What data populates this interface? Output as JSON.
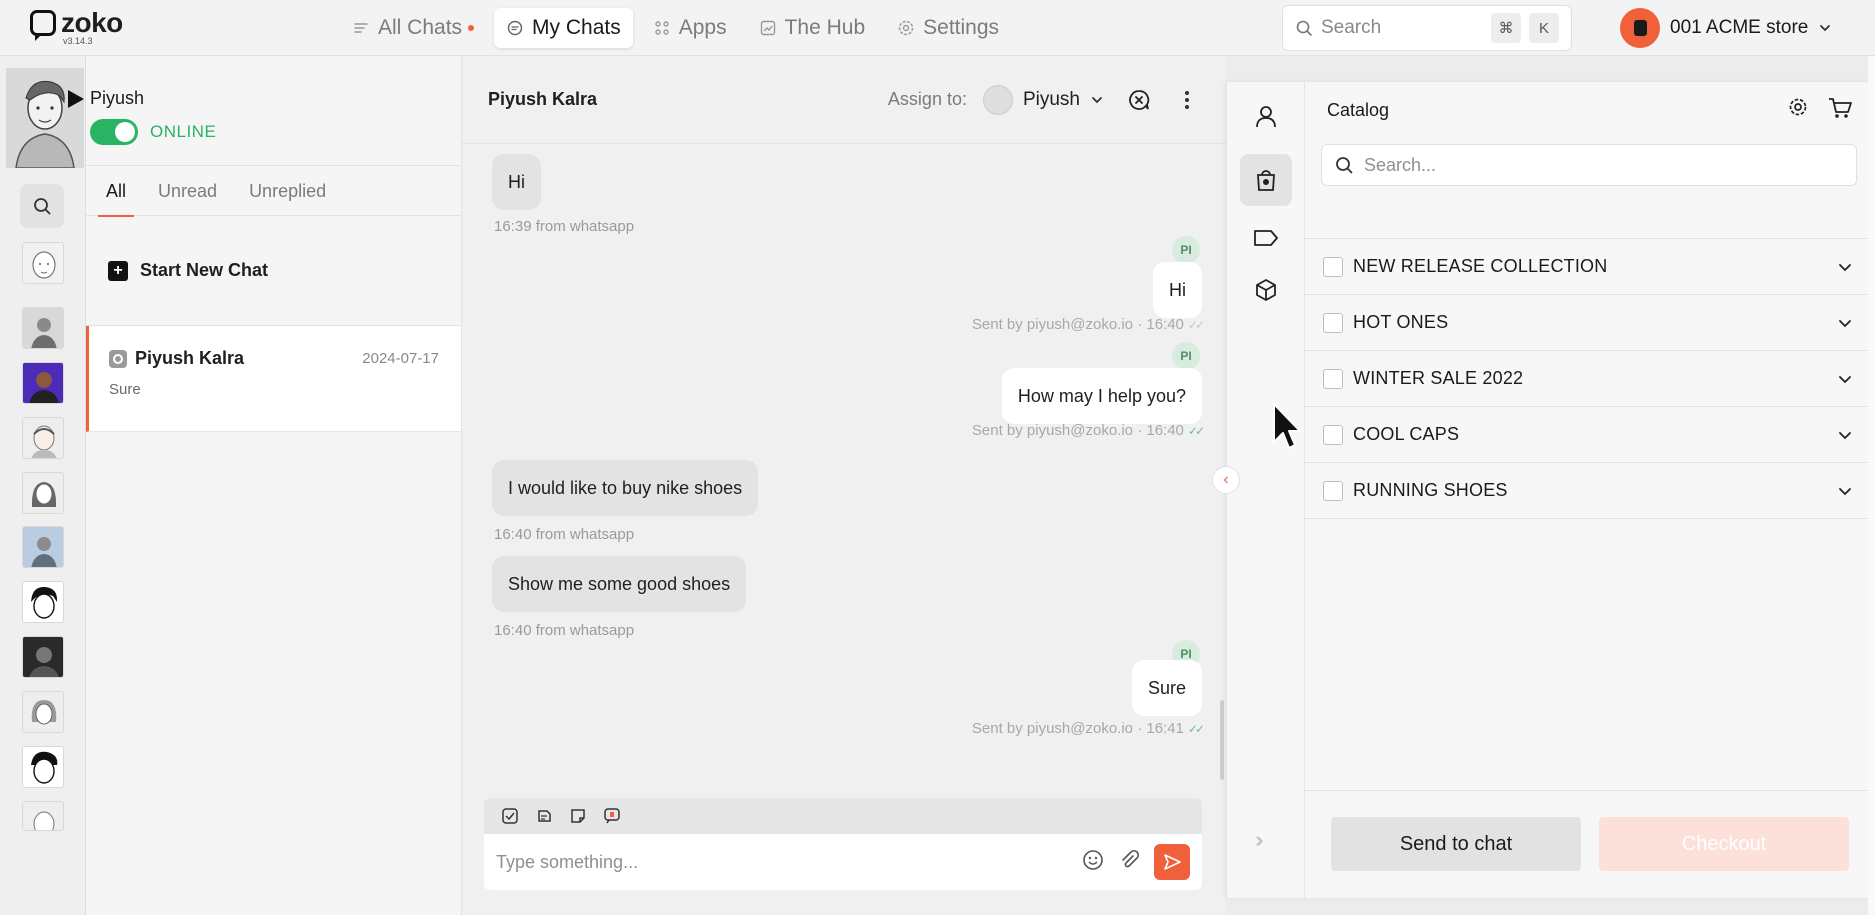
{
  "app": {
    "logo_name": "zoko",
    "version": "v3.14.3"
  },
  "nav": {
    "items": [
      {
        "label": "All Chats",
        "icon": "list-icon",
        "has_dot": true
      },
      {
        "label": "My Chats",
        "icon": "chat-bubble-icon",
        "active": true
      },
      {
        "label": "Apps",
        "icon": "grid-icon"
      },
      {
        "label": "The Hub",
        "icon": "chart-icon"
      },
      {
        "label": "Settings",
        "icon": "gear-icon"
      }
    ],
    "search_placeholder": "Search",
    "shortcut_keys": [
      "⌘",
      "K"
    ],
    "store_name": "001 ACME store"
  },
  "agent": {
    "name": "Piyush",
    "status": "ONLINE"
  },
  "chat_list": {
    "tabs": [
      "All",
      "Unread",
      "Unreplied"
    ],
    "active_tab": "All",
    "start_new_chat": "Start New Chat",
    "chats": [
      {
        "name": "Piyush Kalra",
        "date": "2024-07-17",
        "preview": "Sure"
      }
    ]
  },
  "conversation": {
    "title": "Piyush Kalra",
    "assign_label": "Assign to:",
    "assignee": "Piyush",
    "messages": [
      {
        "dir": "in",
        "text": "Hi",
        "meta": "16:39 from whatsapp"
      },
      {
        "dir": "out",
        "text": "Hi",
        "meta": "Sent by piyush@zoko.io · 16:40",
        "sender_badge": "PI",
        "ticks": "grey"
      },
      {
        "dir": "out",
        "text": "How may I help you?",
        "meta": "Sent by piyush@zoko.io · 16:40",
        "sender_badge": "PI",
        "ticks": "green"
      },
      {
        "dir": "in",
        "text": "I would like to buy nike shoes",
        "meta": "16:40 from whatsapp"
      },
      {
        "dir": "in",
        "text": "Show me some good shoes",
        "meta": "16:40 from whatsapp"
      },
      {
        "dir": "out",
        "text": "Sure",
        "meta": "Sent by piyush@zoko.io · 16:41",
        "sender_badge": "PI",
        "ticks": "green"
      }
    ],
    "composer_placeholder": "Type something..."
  },
  "catalog": {
    "title": "Catalog",
    "search_placeholder": "Search...",
    "collections": [
      "NEW RELEASE COLLECTION",
      "HOT ONES",
      "WINTER SALE 2022",
      "COOL CAPS",
      "RUNNING SHOES"
    ],
    "send_to_chat": "Send to chat",
    "checkout": "Checkout"
  },
  "colors": {
    "accent": "#f0603a",
    "online": "#28b463"
  }
}
